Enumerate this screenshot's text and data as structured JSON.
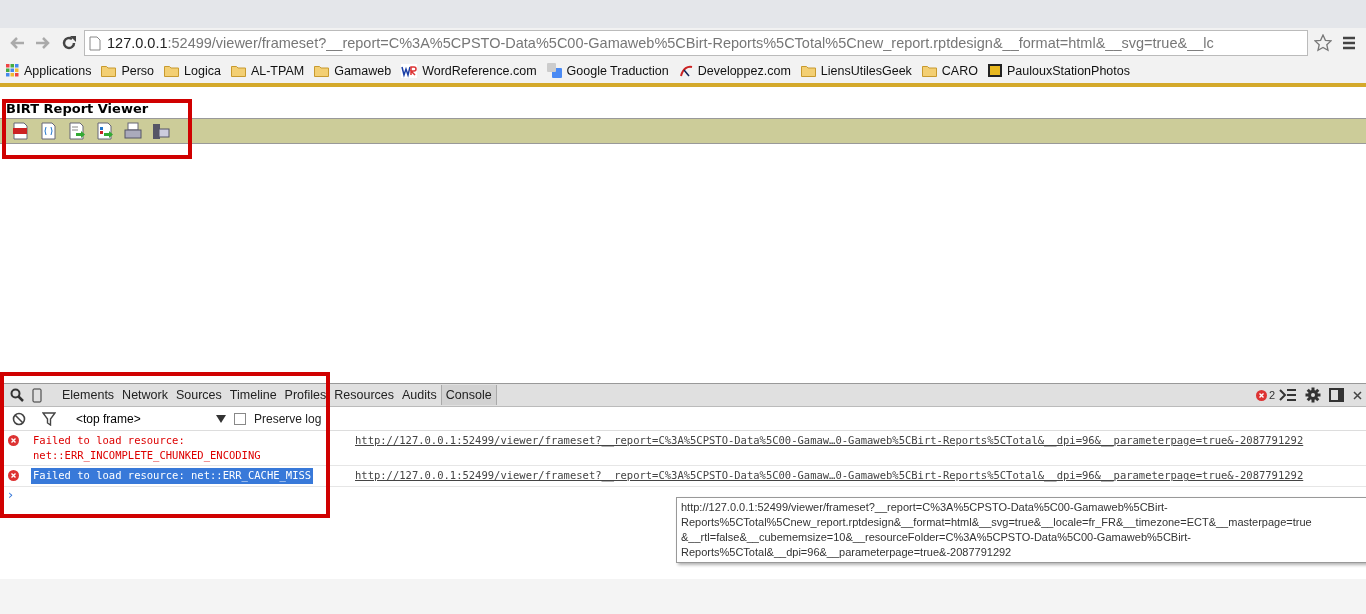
{
  "browser": {
    "address": {
      "host": "127.0.0.1",
      "rest": ":52499/viewer/frameset?__report=C%3A%5CPSTO-Data%5C00-Gamaweb%5CBirt-Reports%5CTotal%5Cnew_report.rptdesign&__format=html&__svg=true&__lc"
    },
    "bookmarks": [
      {
        "kind": "apps",
        "label": "Applications"
      },
      {
        "kind": "folder",
        "label": "Perso"
      },
      {
        "kind": "folder",
        "label": "Logica"
      },
      {
        "kind": "folder",
        "label": "AL-TPAM"
      },
      {
        "kind": "folder",
        "label": "Gamaweb"
      },
      {
        "kind": "wr",
        "label": "WordReference.com"
      },
      {
        "kind": "translate",
        "label": "Google Traduction"
      },
      {
        "kind": "dev",
        "label": "Developpez.com"
      },
      {
        "kind": "folder",
        "label": "LiensUtilesGeek"
      },
      {
        "kind": "folder",
        "label": "CARO"
      },
      {
        "kind": "photo",
        "label": "PaulouxStationPhotos"
      }
    ]
  },
  "viewer": {
    "title": "BIRT Report Viewer",
    "tools": [
      {
        "kind": "toc"
      },
      {
        "kind": "params"
      },
      {
        "kind": "export"
      },
      {
        "kind": "export-report"
      },
      {
        "kind": "print"
      },
      {
        "kind": "print-server"
      }
    ]
  },
  "devtools": {
    "tabs": [
      {
        "label": "Elements",
        "selected": false
      },
      {
        "label": "Network",
        "selected": false
      },
      {
        "label": "Sources",
        "selected": false
      },
      {
        "label": "Timeline",
        "selected": false
      },
      {
        "label": "Profiles",
        "selected": false
      },
      {
        "label": "Resources",
        "selected": false
      },
      {
        "label": "Audits",
        "selected": false
      },
      {
        "label": "Console",
        "selected": true
      }
    ],
    "error_count": "2",
    "frame_select": "<top frame>",
    "preserve_log": {
      "label": "Preserve log",
      "checked": false
    },
    "messages": [
      {
        "text": "Failed to load resource: net::ERR_INCOMPLETE_CHUNKED_ENCODING",
        "selected": false,
        "source": "http://127.0.0.1:52499/viewer/frameset?__report=C%3A%5CPSTO-Data%5C00-Gamaw…0-Gamaweb%5CBirt-Reports%5CTotal&__dpi=96&__parameterpage=true&-2087791292"
      },
      {
        "text": "Failed to load resource: net::ERR_CACHE_MISS",
        "selected": true,
        "source": "http://127.0.0.1:52499/viewer/frameset?__report=C%3A%5CPSTO-Data%5C00-Gamaw…0-Gamaweb%5CBirt-Reports%5CTotal&__dpi=96&__parameterpage=true&-2087791292"
      }
    ],
    "prompt": "›",
    "tooltip": [
      "http://127.0.0.1:52499/viewer/frameset?__report=C%3A%5CPSTO-Data%5C00-Gamaweb%5CBirt-",
      "Reports%5CTotal%5Cnew_report.rptdesign&__format=html&__svg=true&__locale=fr_FR&__timezone=ECT&__masterpage=true",
      "&__rtl=false&__cubememsize=10&__resourceFolder=C%3A%5CPSTO-Data%5C00-Gamaweb%5CBirt-",
      "Reports%5CTotal&__dpi=96&__parameterpage=true&-2087791292"
    ]
  }
}
